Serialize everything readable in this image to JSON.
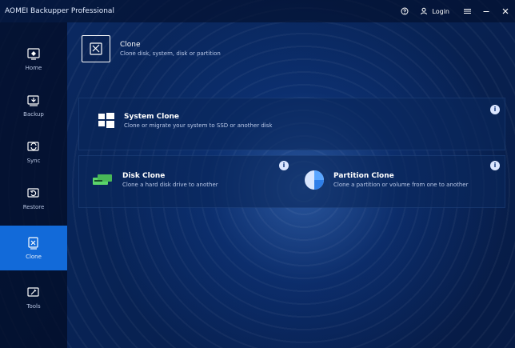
{
  "window": {
    "title": "AOMEI Backupper Professional",
    "login_label": "Login"
  },
  "sidebar": {
    "items": [
      {
        "label": "Home"
      },
      {
        "label": "Backup"
      },
      {
        "label": "Sync"
      },
      {
        "label": "Restore"
      },
      {
        "label": "Clone"
      },
      {
        "label": "Tools"
      }
    ],
    "active_index": 4
  },
  "main": {
    "section": {
      "title": "Clone",
      "subtitle": "Clone disk, system, disk or partition"
    },
    "cards": [
      {
        "title": "System Clone",
        "description": "Clone or migrate your system to SSD or another disk"
      },
      {
        "title": "Disk Clone",
        "description": "Clone a hard disk drive to another"
      },
      {
        "title": "Partition Clone",
        "description": "Clone a partition or volume from one to another"
      }
    ]
  },
  "colors": {
    "background": "#071b45",
    "sidebar": "#020d26",
    "active_sidebar": "#126ad9",
    "card": "#09275b",
    "text": "#ffffff"
  }
}
